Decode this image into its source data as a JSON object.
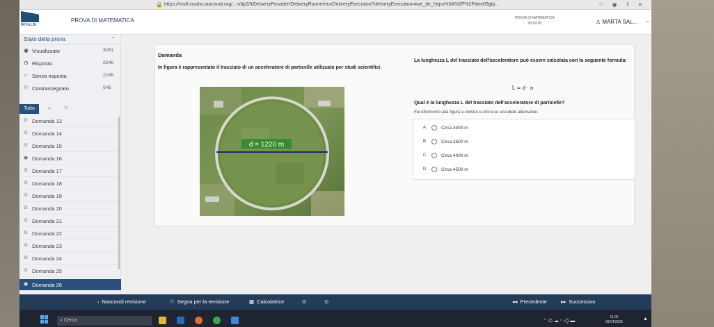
{
  "browser": {
    "url": "https://ms8.invalsi.taocloud.org/...n/dy2/ltiDeliveryProvider/DeliveryRunner/runDeliveryExecution?deliveryExecution=kve_de_https%3A%2F%2Fitinv09glp..."
  },
  "header": {
    "logo_text": "INVALSI",
    "title": "PROVA DI MATEMATICA",
    "test_label": "PROVA DI MATEMATICA",
    "timer": "00:59:38",
    "user": "MARTA SAL..."
  },
  "sidebar": {
    "title": "Stato della prova",
    "stats": [
      {
        "icon": "eye-icon",
        "label": "Visualizzato",
        "count": "30/51"
      },
      {
        "icon": "radio-checked-icon",
        "label": "Risposto",
        "count": "23/45"
      },
      {
        "icon": "radio-empty-icon",
        "label": "Senza risposta",
        "count": "22/45"
      },
      {
        "icon": "flag-icon",
        "label": "Contrassegnato",
        "count": "0/45"
      }
    ],
    "filters": {
      "all": "Tutto"
    },
    "questions": [
      {
        "label": "Domanda 13"
      },
      {
        "label": "Domanda 14"
      },
      {
        "label": "Domanda 15"
      },
      {
        "label": "Domanda 16"
      },
      {
        "label": "Domanda 17"
      },
      {
        "label": "Domanda 18"
      },
      {
        "label": "Domanda 19"
      },
      {
        "label": "Domanda 20"
      },
      {
        "label": "Domanda 21"
      },
      {
        "label": "Domanda 22"
      },
      {
        "label": "Domanda 23"
      },
      {
        "label": "Domanda 24"
      },
      {
        "label": "Domanda 25"
      },
      {
        "label": "Domanda 26"
      }
    ]
  },
  "question": {
    "heading": "Domanda",
    "text": "In figura è rappresentato il tracciato di un acceleratore di particelle utilizzato per studi scientifici.",
    "image_label": "d = 1220 m",
    "formula_intro": "La lunghezza L del tracciato dell'acceleratore può essere calcolata con la seguente formula:",
    "formula": "L = d · π",
    "prompt": "Qual è la lunghezza L del tracciato dell'acceleratore di particelle?",
    "hint": "Fai riferimento alla figura a sinistra e clicca su una delle alternative.",
    "choices": [
      {
        "key": "A",
        "text": "Circa 3000 m"
      },
      {
        "key": "B",
        "text": "Circa 3500 m"
      },
      {
        "key": "C",
        "text": "Circa 4000 m"
      },
      {
        "key": "D",
        "text": "Circa 4500 m"
      }
    ]
  },
  "navbar": {
    "hide_review": "Nascondi revisione",
    "flag_review": "Segna per la revisione",
    "calculator": "Calcolatrice",
    "previous": "Precedente",
    "next": "Successivo"
  },
  "taskbar": {
    "search_placeholder": "Cerca",
    "time": "11:06",
    "date": "08/04/2025"
  },
  "colors": {
    "primary": "#2a4f7d",
    "navbar": "#243c5a",
    "taskbar": "#1f2530"
  }
}
